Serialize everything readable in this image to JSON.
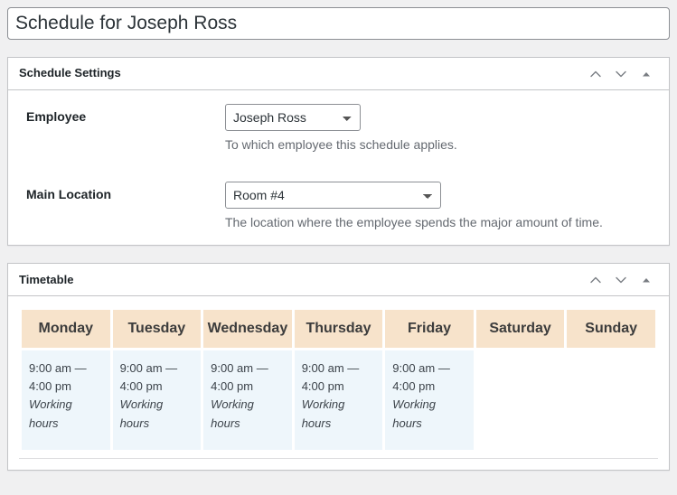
{
  "page": {
    "title_value": "Schedule for Joseph Ross",
    "title_placeholder": "Add title"
  },
  "panels": {
    "settings": {
      "heading": "Schedule Settings",
      "move_up_label": "Move up",
      "move_down_label": "Move down",
      "toggle_label": "Toggle panel",
      "fields": [
        {
          "label": "Employee",
          "value": "Joseph Ross",
          "description": "To which employee this schedule applies."
        },
        {
          "label": "Main Location",
          "value": "Room #4",
          "description": "The location where the employee spends the major amount of time."
        }
      ]
    },
    "timetable": {
      "heading": "Timetable",
      "move_up_label": "Move up",
      "move_down_label": "Move down",
      "toggle_label": "Toggle panel",
      "columns": [
        "Monday",
        "Tuesday",
        "Wednesday",
        "Thursday",
        "Friday",
        "Saturday",
        "Sunday"
      ],
      "cells": [
        {
          "time": "9:00 am — 4:00 pm",
          "label": "Working hours"
        },
        {
          "time": "9:00 am — 4:00 pm",
          "label": "Working hours"
        },
        {
          "time": "9:00 am — 4:00 pm",
          "label": "Working hours"
        },
        {
          "time": "9:00 am — 4:00 pm",
          "label": "Working hours"
        },
        {
          "time": "9:00 am — 4:00 pm",
          "label": "Working hours"
        },
        {
          "time": "",
          "label": ""
        },
        {
          "time": "",
          "label": ""
        }
      ]
    }
  },
  "colors": {
    "page_bg": "#f0f0f1",
    "panel_bg": "#ffffff",
    "panel_border": "#c3c4c7",
    "header_cell_bg": "#f7e3cb",
    "shift_cell_bg": "#eef6fb",
    "text": "#3c434a",
    "muted_text": "#646970"
  }
}
